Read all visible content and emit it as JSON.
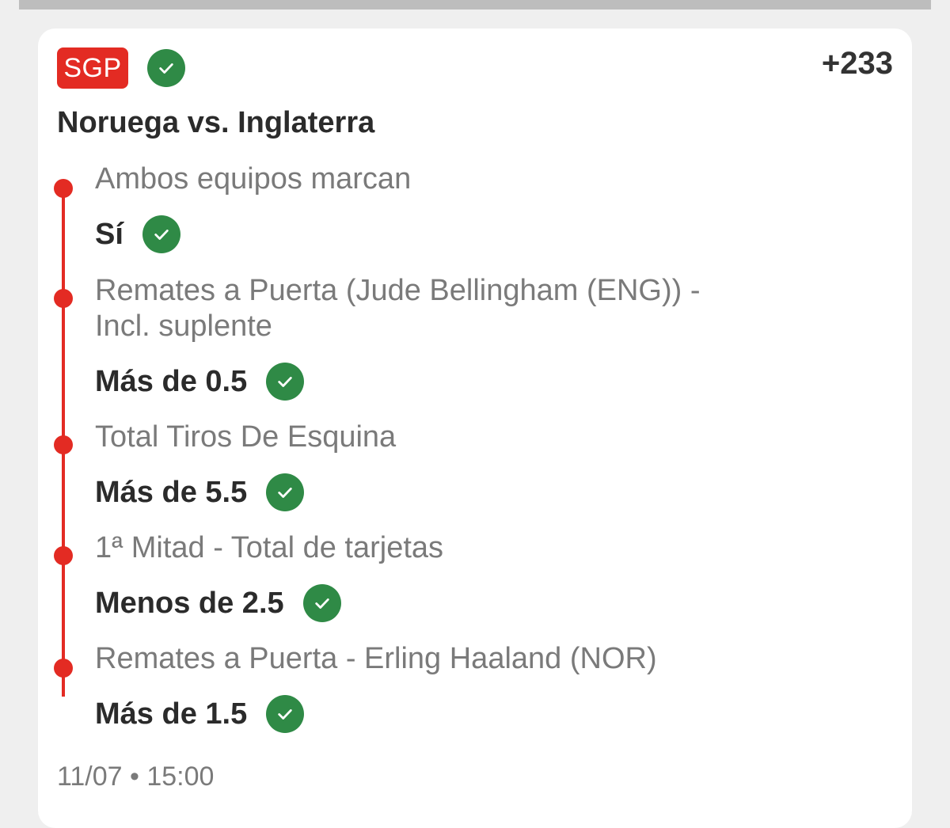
{
  "bet": {
    "badge": "SGP",
    "odds": "+233",
    "match": "Noruega vs. Inglaterra",
    "datetime": "11/07 • 15:00",
    "status_icon": "check-circle-icon",
    "legs": [
      {
        "market": "Ambos equipos marcan",
        "selection": "Sí"
      },
      {
        "market_line1": "Remates a Puerta (Jude Bellingham (ENG)) -",
        "market_line2": "Incl. suplente",
        "selection": "Más de 0.5"
      },
      {
        "market": "Total Tiros De Esquina",
        "selection": "Más de 5.5"
      },
      {
        "market": "1ª Mitad - Total de tarjetas",
        "selection": "Menos de 2.5"
      },
      {
        "market": "Remates a Puerta - Erling Haaland (NOR)",
        "selection": "Más de 1.5"
      }
    ]
  },
  "colors": {
    "accent_red": "#e32b23",
    "win_green": "#2f8a46"
  }
}
